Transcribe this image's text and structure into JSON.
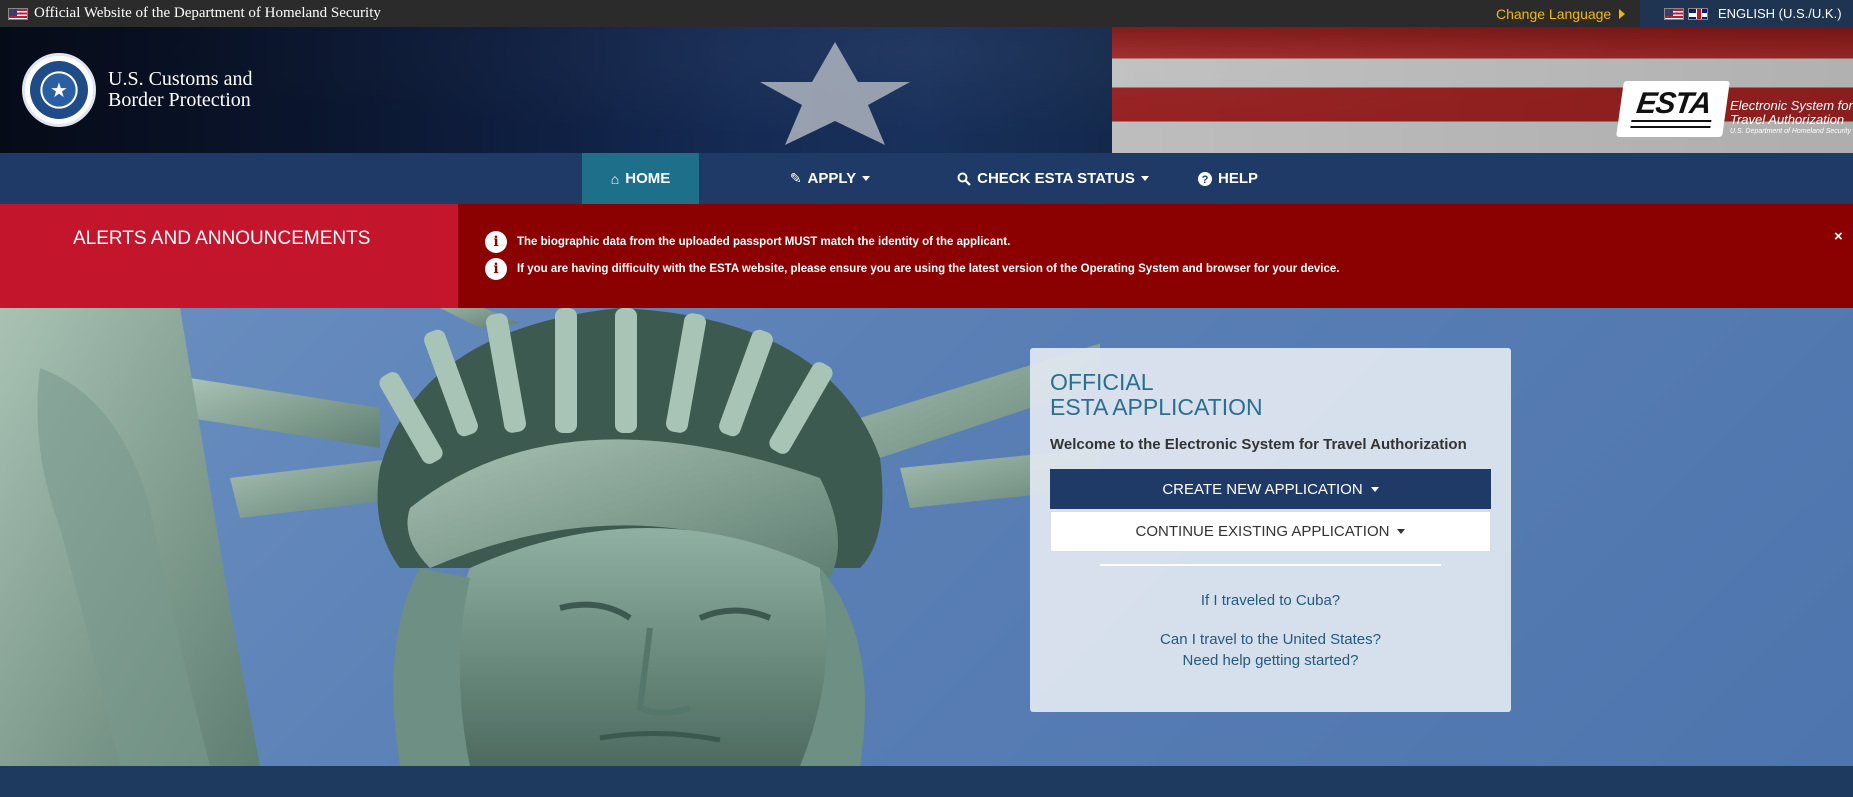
{
  "topbar": {
    "official_text": "Official Website of the Department of Homeland Security",
    "change_language": "Change Language",
    "language": "ENGLISH (U.S./U.K.)"
  },
  "header": {
    "agency_line1": "U.S. Customs and",
    "agency_line2": "Border Protection",
    "esta_logo_word": "ESTA",
    "esta_line1": "Electronic System for",
    "esta_line2": "Travel Authorization",
    "esta_line3": "U.S. Department of Homeland Security"
  },
  "nav": {
    "home": "HOME",
    "apply": "APPLY",
    "check_status": "CHECK ESTA STATUS",
    "help": "HELP"
  },
  "alerts": {
    "title": "ALERTS AND ANNOUNCEMENTS",
    "items": [
      "The biographic data from the uploaded passport MUST match the identity of the applicant.",
      "If you are having difficulty with the ESTA website, please ensure you are using the latest version of the Operating System and browser for your device."
    ],
    "close": "×"
  },
  "card": {
    "title_line1": "OFFICIAL",
    "title_line2": "ESTA APPLICATION",
    "welcome": "Welcome to the Electronic System for Travel Authorization",
    "create_button": "CREATE NEW APPLICATION",
    "continue_button": "CONTINUE EXISTING APPLICATION",
    "link_cuba": "If I traveled to Cuba?",
    "link_travel": "Can I travel to the United States?",
    "link_help": "Need help getting started?"
  },
  "icons": {
    "home": "home-icon",
    "apply": "pencil-icon",
    "check": "search-icon",
    "help": "question-circle-icon",
    "info": "info-circle-icon",
    "close": "close-icon"
  },
  "colors": {
    "nav_bg": "#1f3a66",
    "nav_active": "#1d6f8a",
    "alert_bg": "#8b0000",
    "alert_title_bg": "#c3162c",
    "change_language": "#f5b800",
    "card_title": "#2a6f8e"
  }
}
